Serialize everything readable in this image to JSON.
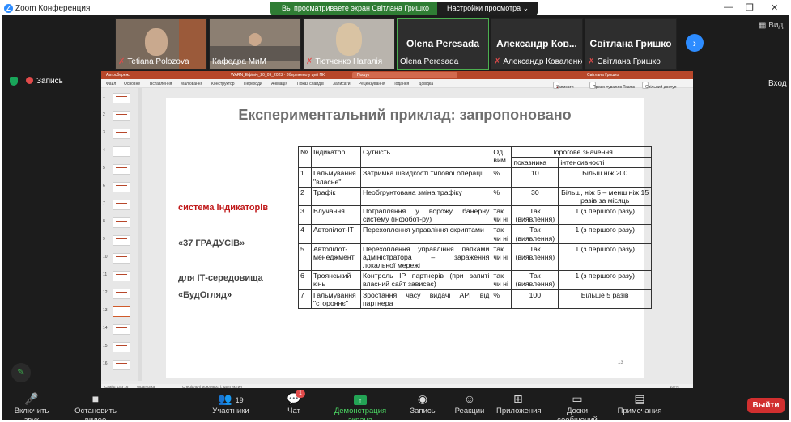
{
  "app": {
    "title": "Zoom Конференция",
    "minimize": "—",
    "restore": "❐",
    "close": "✕"
  },
  "share_bar": {
    "message": "Вы просматриваете экран Світлана Гришко",
    "options": "Настройки просмотра"
  },
  "participants": [
    {
      "name": "Tetiana Polozova"
    },
    {
      "name": "Кафедра МиМ"
    },
    {
      "name": "Тютченко Наталія"
    },
    {
      "name": "Olena Peresada",
      "display": "Olena Peresada"
    },
    {
      "name": "Александр Коваленко",
      "display": "Александр Ков..."
    },
    {
      "name": "Світлана Гришко",
      "display": "Світлана Гришко"
    }
  ],
  "view_label": "Вид",
  "recording_label": "Запись",
  "exit_label": "Вход",
  "powerpoint": {
    "autosave": "Автосбереж.",
    "file": "WARN_Ефіміч_20_09_2023 · Збережено у цей ПК",
    "search": "Пошук",
    "user": "Світлана Гришко",
    "menu": [
      "Файл",
      "Основне",
      "Вставлення",
      "Малювання",
      "Конструктор",
      "Переходи",
      "Анімація",
      "Показ слайдів",
      "Записати",
      "Рецензування",
      "Подання",
      "Довідка"
    ],
    "record_btn": "Записати",
    "present_btn": "Презентувати в Teams",
    "share_btn": "Спільний доступ",
    "thumbs": [
      "1",
      "2",
      "3",
      "4",
      "5",
      "6",
      "7",
      "8",
      "9",
      "10",
      "11",
      "12",
      "13",
      "14",
      "15",
      "16"
    ],
    "status_slide": "Слайд 13 з 16",
    "status_lang": "українська",
    "status_access": "Спеціальні можливості: здоїї як тин",
    "status_zoom": "107%"
  },
  "slide": {
    "title": "Експериментальний приклад: запропоновано",
    "left_red": "система індикаторів",
    "left_2": "«37 ГРАДУСІВ»",
    "left_3": "для ІТ-середовища",
    "left_4a": "«БудОгляд",
    "left_4b": "»",
    "page_num": "13",
    "table": {
      "h_no": "№",
      "h_ind": "Індикатор",
      "h_ess": "Сутність",
      "h_unit": "Од. вим.",
      "h_thr": "Порогове значення",
      "h_val": "показника",
      "h_int": "інтенсивності",
      "rows": [
        {
          "no": "1",
          "ind": "Гальмування \"власне\"",
          "ess": "Затримка швидкості типової операції",
          "unit": "%",
          "val": "10",
          "int": "Більш ніж 200"
        },
        {
          "no": "2",
          "ind": "Трафік",
          "ess": "Необгрунтована зміна трафіку",
          "unit": "%",
          "val": "30",
          "int": "Більш, ніж 5 – менш ніж 15 разів за місяць"
        },
        {
          "no": "3",
          "ind": "Влучання",
          "ess": "Потрапляння у ворожу банерну систему (інфобот-ру)",
          "unit": "так чи ні",
          "val": "Так (виявлення)",
          "int": "1 (з першого разу)"
        },
        {
          "no": "4",
          "ind": "Автопілот-ІТ",
          "ess": "Перехоплення управління скриптами",
          "unit": "так чи ні",
          "val": "Так (виявлення)",
          "int": "1 (з першого разу)"
        },
        {
          "no": "5",
          "ind": "Автопілот-менеджмент",
          "ess": "Перехоплення управління папками адміністратора – зараження локальної мережі",
          "unit": "так чи ні",
          "val": "Так (виявлення)",
          "int": "1 (з першого разу)"
        },
        {
          "no": "6",
          "ind": "Троянський кінь",
          "ess": "Контроль ІР партнерів (при запиті власний сайт зависає)",
          "unit": "так чи ні",
          "val": "Так (виявлення)",
          "int": "1 (з першого разу)"
        },
        {
          "no": "7",
          "ind": "Гальмування \"стороннє\"",
          "ess": "Зростання часу видачі API від партнера",
          "unit": "%",
          "val": "100",
          "int": "Більше 5 разів"
        }
      ]
    }
  },
  "toolbar": {
    "mute": "Включить звук",
    "video": "Остановить видео",
    "participants": "Участники",
    "participants_count": "19",
    "chat": "Чат",
    "chat_badge": "1",
    "share": "Демонстрация экрана",
    "record": "Запись",
    "reactions": "Реакции",
    "apps": "Приложения",
    "whiteboards": "Доски сообщений",
    "notes": "Примечания",
    "leave": "Выйти"
  }
}
